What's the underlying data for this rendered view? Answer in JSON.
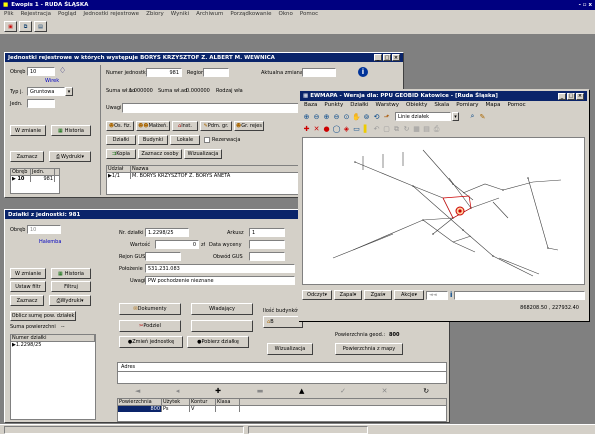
{
  "app": {
    "title": "Ewopis 1 - RUDA ŚLĄSKA",
    "menu": [
      "Plik",
      "Rejestracja",
      "Pogląd",
      "Jednostki rejestrowe",
      "Zbiory",
      "Wyniki",
      "Archiwum",
      "Porządkowanie",
      "Okno",
      "Pomoc"
    ],
    "window_controls": "- ▫ x"
  },
  "status_bar": {
    "left": "",
    "right": ""
  },
  "win_jednostki": {
    "title": "Jednostki rejestrowe w których występuje BORYS KRZYSZTOF Z. ALBERT M. WEWNICA",
    "obreb_label": "Obręb",
    "obreb_value": "10",
    "obreb_name": "Wirek",
    "typ_label": "Typ j.",
    "typ_value": "Gruntowa",
    "jedn_label": "Jedn.",
    "jedn_value": "",
    "btn_w_zmianie": "W zmianie",
    "btn_historia": "Historia",
    "btn_zaznacz": "Zaznacz",
    "btn_wydruki": "Wydruki",
    "grid_headers": [
      "Obręb",
      "Jedn."
    ],
    "grid_rows": [
      [
        "10",
        "981"
      ]
    ],
    "nr_jedn_label": "Numer jednostki",
    "nr_jedn_value": "981",
    "region_label": "Region",
    "region_value": "",
    "aktualna_label": "Aktualna zmiana",
    "aktualna_value": "",
    "suma_wlas_label": "Suma wł.no",
    "suma_wlas_value": "1.000000",
    "suma_wlad_label": "Suma wł.ad",
    "suma_wlad_value": "0.000000",
    "rodzaj_label": "Rodzaj wła",
    "uwagi_label": "Uwagi",
    "btn_os_fiz": "Os. fiz.",
    "btn_malzen": "Małżeń.",
    "btn_inst": "Inst.",
    "btn_pdm": "Pdm. gr.",
    "btn_gr": "Gr. rejes",
    "btn_dzialki": "Działki",
    "btn_budynki": "Budynki",
    "btn_lokale": "Lokale",
    "chk_rezerwacja": "Rezerwacja",
    "btn_kopia": "Kopia",
    "btn_zaznacz_osoby": "Zaznacz osoby",
    "btn_wizualizacja": "Wizualizacja",
    "udzial_headers": [
      "Udział",
      "Nazwa"
    ],
    "udzial_rows": [
      [
        "1/1",
        "M. BORYS KRZYSZTOF  Z. BORYS ANETA"
      ]
    ]
  },
  "win_dzialki": {
    "title": "Działki z jednostki: 981",
    "obreb_label": "Obręb",
    "obreb_value": "10",
    "obreb_name": "Halemba",
    "btn_w_zmianie": "W zmianie",
    "btn_historia": "Historia",
    "btn_ustaw_filtr": "Ustaw filtr",
    "btn_filtruj": "Filtruj",
    "btn_zaznacz": "Zaznacz",
    "btn_wydruki": "Wydruki",
    "btn_oblicz": "Oblicz sumę pow. działek",
    "suma_label": "Suma powierzchni",
    "suma_value": "--",
    "list_header": "Numer działki",
    "list_rows": [
      "1.2298/25"
    ],
    "nr_dzialki_label": "Nr. działki",
    "nr_dzialki_value": "1.2298/25",
    "arkusz_label": "Arkusz",
    "arkusz_value": "1",
    "wartosc_label": "Wartość",
    "wartosc_value": "0",
    "wartosc_unit": "zł",
    "data_wyceny_label": "Data wyceny",
    "rejon_label": "Rejon GUS",
    "obwod_label": "Obwód GUS",
    "polozenie_label": "Położenie",
    "polozenie_value": "531.231.083",
    "uwagi_label": "Uwagi",
    "uwagi_value": "PW pochodzenie nieznane",
    "btn_dokumenty": "Dokumenty",
    "btn_wladajacy": "Władający",
    "btn_podziel": "Podziel",
    "btn_zmien_jedn": "Zmień jednostkę",
    "btn_pobierz": "Pobierz działkę",
    "btn_ilosc": "Ilość budynków",
    "btn_b": "B",
    "pow_geod_label": "Powierzchnia geod.:",
    "pow_geod_value": "800",
    "btn_wizualizacja": "Wizualizacja",
    "btn_pow_z_mapy": "Powierzchnia z mapy",
    "adres_label": "Adres",
    "uzytki_headers": [
      "Powierzchnia",
      "Użytek",
      "Kontur",
      "Klasa"
    ],
    "uzytki_rows": [
      [
        "800",
        "Ps",
        "V",
        ""
      ]
    ]
  },
  "map": {
    "title": "EWMAPA - Wersja dla: PPU GEOBID Katowice - [Ruda Śląska]",
    "menu": [
      "Baza",
      "Punkty",
      "Działki",
      "Warstwy",
      "Obiekty",
      "Skala",
      "Pomiary",
      "Mapa",
      "Pomoc"
    ],
    "layer_select": "Linie działek",
    "bottom_buttons": [
      "Odczyt",
      "Zapal",
      "Zgaś",
      "Akcje"
    ],
    "coords": "868208.50 , 227932.40"
  },
  "colors": {
    "titlebar": "#0a246a",
    "face": "#d4d0c8",
    "label_blue": "#0000c0"
  }
}
